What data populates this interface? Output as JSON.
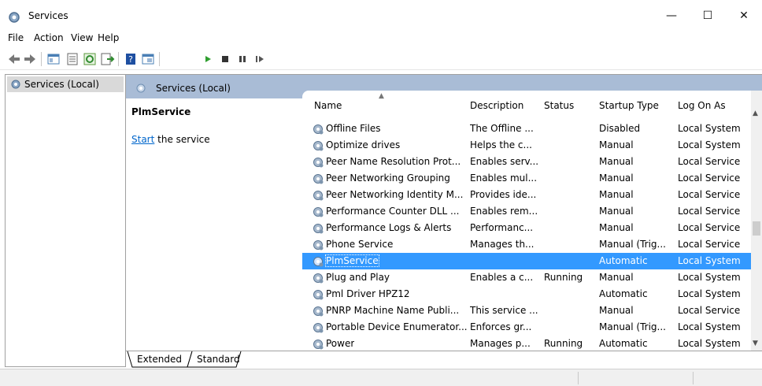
{
  "window": {
    "title": "Services"
  },
  "controls": {
    "minimize": "—",
    "maximize": "☐",
    "close": "✕"
  },
  "menu": [
    "File",
    "Action",
    "View",
    "Help"
  ],
  "tree": {
    "root_label": "Services (Local)"
  },
  "pane": {
    "header_label": "Services (Local)",
    "selected_service": "PlmService",
    "action_link": "Start",
    "action_suffix": " the service"
  },
  "columns": [
    "Name",
    "Description",
    "Status",
    "Startup Type",
    "Log On As"
  ],
  "services": [
    {
      "name": "Offline Files",
      "description": "The Offline ...",
      "status": "",
      "startup": "Disabled",
      "logon": "Local System"
    },
    {
      "name": "Optimize drives",
      "description": "Helps the c...",
      "status": "",
      "startup": "Manual",
      "logon": "Local System"
    },
    {
      "name": "Peer Name Resolution Prot...",
      "description": "Enables serv...",
      "status": "",
      "startup": "Manual",
      "logon": "Local Service"
    },
    {
      "name": "Peer Networking Grouping",
      "description": "Enables mul...",
      "status": "",
      "startup": "Manual",
      "logon": "Local Service"
    },
    {
      "name": "Peer Networking Identity M...",
      "description": "Provides ide...",
      "status": "",
      "startup": "Manual",
      "logon": "Local Service"
    },
    {
      "name": "Performance Counter DLL ...",
      "description": "Enables rem...",
      "status": "",
      "startup": "Manual",
      "logon": "Local Service"
    },
    {
      "name": "Performance Logs & Alerts",
      "description": "Performanc...",
      "status": "",
      "startup": "Manual",
      "logon": "Local Service"
    },
    {
      "name": "Phone Service",
      "description": "Manages th...",
      "status": "",
      "startup": "Manual (Trig...",
      "logon": "Local Service"
    },
    {
      "name": "PlmService",
      "description": "",
      "status": "",
      "startup": "Automatic",
      "logon": "Local System",
      "selected": true
    },
    {
      "name": "Plug and Play",
      "description": "Enables a c...",
      "status": "Running",
      "startup": "Manual",
      "logon": "Local System"
    },
    {
      "name": "Pml Driver HPZ12",
      "description": "",
      "status": "",
      "startup": "Automatic",
      "logon": "Local System"
    },
    {
      "name": "PNRP Machine Name Publi...",
      "description": "This service ...",
      "status": "",
      "startup": "Manual",
      "logon": "Local Service"
    },
    {
      "name": "Portable Device Enumerator...",
      "description": "Enforces gr...",
      "status": "",
      "startup": "Manual (Trig...",
      "logon": "Local System"
    },
    {
      "name": "Power",
      "description": "Manages p...",
      "status": "Running",
      "startup": "Automatic",
      "logon": "Local System"
    }
  ],
  "tabs": [
    "Extended",
    "Standard"
  ],
  "icons": {
    "app": "services-gear-icon",
    "back": "back-arrow-icon",
    "forward": "forward-arrow-icon",
    "start": "play-icon",
    "stop": "stop-icon",
    "pause": "pause-icon",
    "resume": "resume-icon"
  },
  "colors": {
    "selection": "#3399ff",
    "header_band": "#a9bcd6"
  }
}
